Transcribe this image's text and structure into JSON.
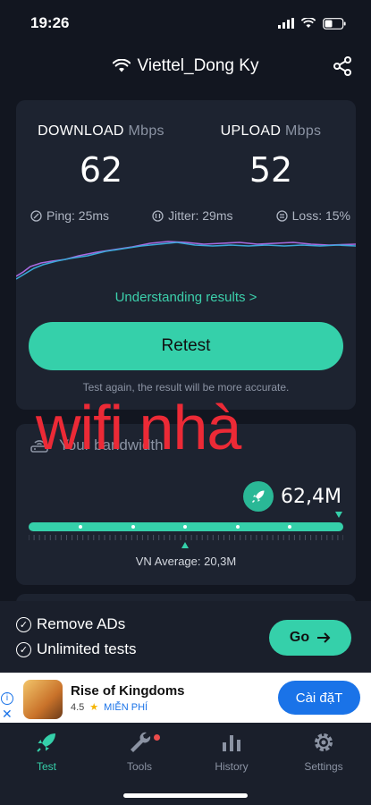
{
  "status_bar": {
    "time": "19:26"
  },
  "header": {
    "network_name": "Viettel_Dong Ky"
  },
  "result": {
    "download_label": "DOWNLOAD",
    "download_unit": "Mbps",
    "download_value": "62",
    "upload_label": "UPLOAD",
    "upload_unit": "Mbps",
    "upload_value": "52",
    "ping": "Ping: 25ms",
    "jitter": "Jitter: 29ms",
    "loss": "Loss: 15%",
    "understanding_link": "Understanding results >",
    "retest_label": "Retest",
    "retest_hint": "Test again, the result will be more accurate."
  },
  "overlay_text": "wifi nhà",
  "bandwidth": {
    "title": "Your bandwidth",
    "value": "62,4M",
    "average": "VN Average: 20,3M"
  },
  "promo": {
    "item1": "Remove ADs",
    "item2": "Unlimited tests",
    "go_label": "Go"
  },
  "ad": {
    "title": "Rise of Kingdoms",
    "rating": "4.5",
    "price": "MIỄN PHÍ",
    "install_label": "Cài đặT"
  },
  "tabs": [
    {
      "label": "Test"
    },
    {
      "label": "Tools"
    },
    {
      "label": "History"
    },
    {
      "label": "Settings"
    }
  ],
  "colors": {
    "accent": "#35d0aa",
    "background": "#121620",
    "card": "#1d2330",
    "overlay": "#ec2a36"
  }
}
